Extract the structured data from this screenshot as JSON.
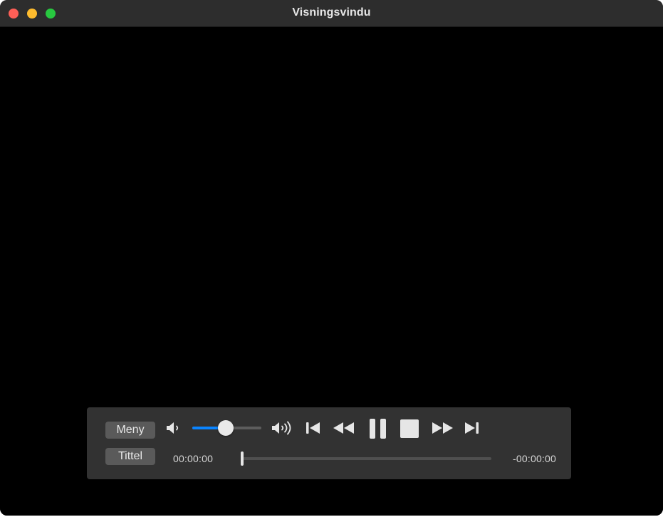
{
  "window": {
    "title": "Visningsvindu"
  },
  "controls": {
    "menu_label": "Meny",
    "title_label": "Tittel",
    "volume_level": 0.48,
    "time_elapsed": "00:00:00",
    "time_remaining": "-00:00:00",
    "playback_progress": 0.0,
    "icons": {
      "volume_low": "speaker-low-icon",
      "volume_high": "speaker-high-icon",
      "previous": "skip-back-icon",
      "rewind": "rewind-icon",
      "pause": "pause-icon",
      "stop": "stop-icon",
      "fast_forward": "fast-forward-icon",
      "next": "skip-forward-icon"
    }
  },
  "colors": {
    "traffic_close": "#fe5f57",
    "traffic_minimize": "#febc2e",
    "traffic_zoom": "#28c840",
    "volume_accent": "#0a84ff",
    "controller_bg": "#323232"
  }
}
